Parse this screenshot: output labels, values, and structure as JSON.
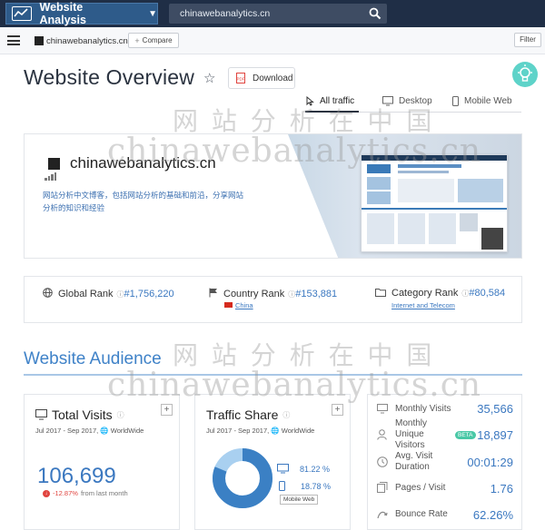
{
  "topbar": {
    "app_title": "Website Analysis",
    "search_value": "chinawebanalytics.cn"
  },
  "subbar": {
    "site_name": "chinawebanalytics.cn",
    "compare_label": "Compare",
    "filter_label": "Filter"
  },
  "header": {
    "title": "Website Overview",
    "download_label": "Download"
  },
  "tabs": [
    {
      "label": "All traffic"
    },
    {
      "label": "Desktop"
    },
    {
      "label": "Mobile Web"
    }
  ],
  "watermarks": {
    "cn": "网 站 分 析 在 中 国",
    "en": "chinawebanalytics.cn"
  },
  "site_card": {
    "domain": "chinawebanalytics.cn",
    "description": "网站分析中文博客，包括网站分析的基础和前沿，分享网站分析的知识和经验"
  },
  "ranks": {
    "global": {
      "label": "Global Rank",
      "value": "#1,756,220"
    },
    "country": {
      "label": "Country Rank",
      "value": "#153,881",
      "sub": "China"
    },
    "category": {
      "label": "Category Rank",
      "value": "#80,584",
      "sub": "Internet and Telecom"
    }
  },
  "audience": {
    "title": "Website Audience"
  },
  "total_visits": {
    "title": "Total Visits",
    "period": "Jul 2017 - Sep 2017,",
    "region": "WorldWide",
    "value": "106,699",
    "delta": "-12.87%",
    "delta_suffix": "from last month"
  },
  "traffic_share": {
    "title": "Traffic Share",
    "period": "Jul 2017 - Sep 2017,",
    "region": "WorldWide",
    "desktop_pct": "81.22 %",
    "mobile_pct": "18.78 %",
    "tooltip": "Mobile Web",
    "desktop_fraction": 0.8122
  },
  "metrics": [
    {
      "label": "Monthly Visits",
      "value": "35,566"
    },
    {
      "label": "Monthly Unique Visitors",
      "value": "18,897",
      "badge": "BETA"
    },
    {
      "label": "Avg. Visit Duration",
      "value": "00:01:29"
    },
    {
      "label": "Pages / Visit",
      "value": "1.76"
    },
    {
      "label": "Bounce Rate",
      "value": "62.26%"
    }
  ],
  "colors": {
    "topbar": "#1f2e46",
    "accent_blue": "#3b78c0",
    "negative": "#e0443f",
    "teal": "#5ed3c9"
  }
}
